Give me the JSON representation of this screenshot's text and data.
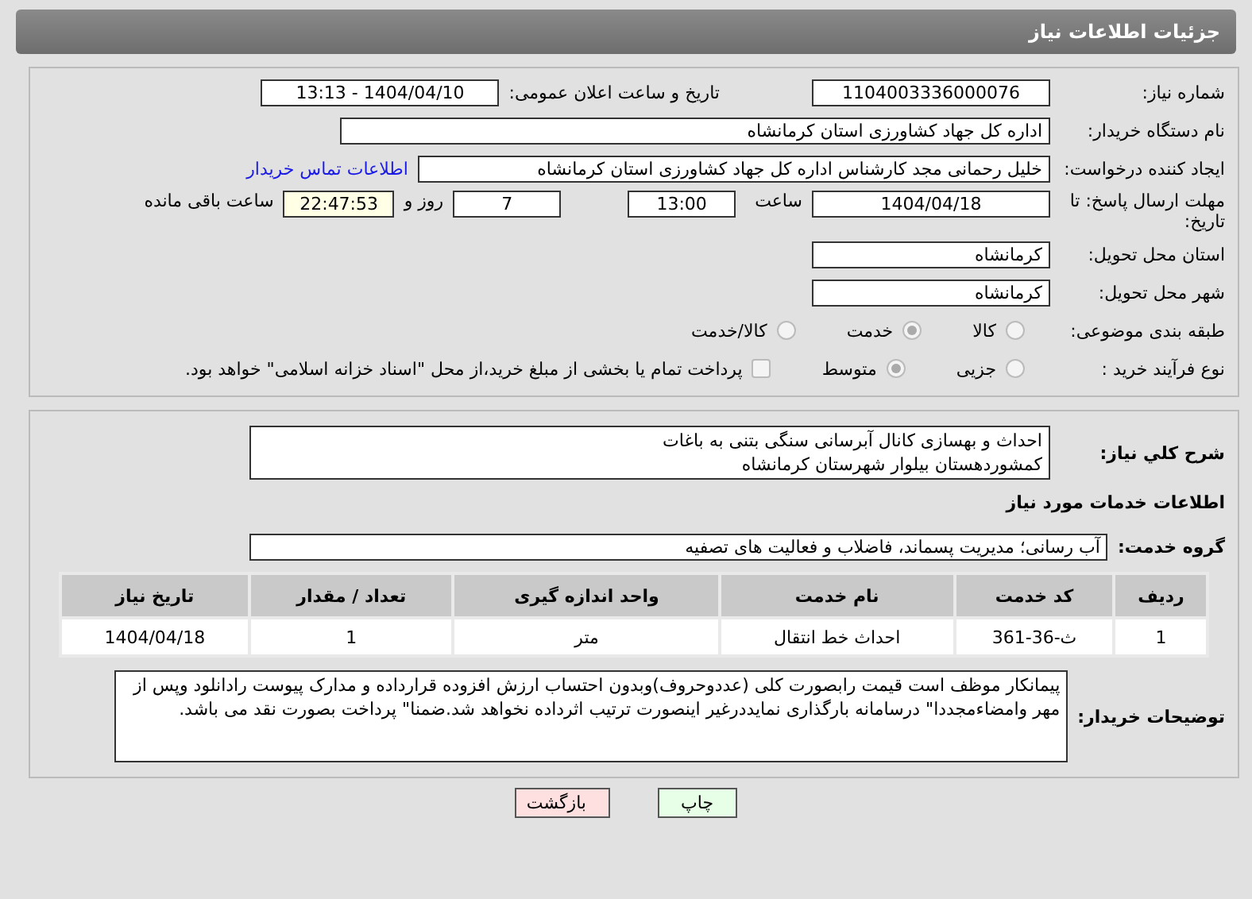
{
  "title": "جزئیات اطلاعات نیاز",
  "need_number": {
    "label": "شماره نیاز:",
    "value": "1104003336000076"
  },
  "announce": {
    "label": "تاریخ و ساعت اعلان عمومی:",
    "value": "1404/04/10 - 13:13"
  },
  "buyer": {
    "label": "نام دستگاه خریدار:",
    "value": "اداره کل جهاد کشاورزی استان کرمانشاه"
  },
  "requester": {
    "label": "ایجاد کننده درخواست:",
    "value": "خلیل رحمانی مجد کارشناس اداره کل جهاد کشاورزی استان کرمانشاه",
    "link": "اطلاعات تماس خریدار"
  },
  "deadline": {
    "label": "مهلت ارسال پاسخ: تا تاریخ:",
    "date": "1404/04/18",
    "time_label": "ساعت",
    "time": "13:00",
    "days": "7",
    "days_label": "روز و",
    "remaining": "22:47:53",
    "remaining_label": "ساعت باقی مانده"
  },
  "province": {
    "label": "استان محل تحویل:",
    "value": "کرمانشاه"
  },
  "city": {
    "label": "شهر محل تحویل:",
    "value": "کرمانشاه"
  },
  "category": {
    "label": "طبقه بندی موضوعی:",
    "options": [
      {
        "label": "کالا",
        "selected": false
      },
      {
        "label": "خدمت",
        "selected": true
      },
      {
        "label": "کالا/خدمت",
        "selected": false
      }
    ]
  },
  "purchase_type": {
    "label": "نوع فرآیند خرید :",
    "options": [
      {
        "label": "جزیی",
        "selected": false
      },
      {
        "label": "متوسط",
        "selected": true
      }
    ],
    "payment": {
      "checked": false,
      "label": "پرداخت تمام یا بخشی از مبلغ خرید،از محل \"اسناد خزانه اسلامی\" خواهد بود."
    }
  },
  "summary": {
    "label": "شرح کلي نیاز:",
    "lines": [
      "احداث و بهسازی کانال آبرسانی سنگی بتنی به باغات",
      "کمشوردهستان بیلوار شهرستان کرمانشاه"
    ]
  },
  "services_title": "اطلاعات خدمات مورد نیاز",
  "service_group": {
    "label": "گروه خدمت:",
    "value": "آب رسانی؛ مدیریت پسماند، فاضلاب و فعالیت های تصفیه"
  },
  "table": {
    "columns": [
      "ردیف",
      "کد خدمت",
      "نام خدمت",
      "واحد اندازه گیری",
      "تعداد / مقدار",
      "تاریخ نیاز"
    ],
    "rows": [
      [
        "1",
        "ث-36-361",
        "احداث خط انتقال",
        "متر",
        "1",
        "1404/04/18"
      ]
    ]
  },
  "notes": {
    "label": "توضیحات خریدار:",
    "value": "پیمانکار موظف است قیمت رابصورت کلی (عددوحروف)وبدون احتساب ارزش افزوده قرارداده و مدارک پیوست رادانلود وپس از مهر وامضاءمجددا\" درسامانه بارگذاری نمایددرغیر اینصورت ترتیب اثرداده نخواهد شد.ضمنا\" پرداخت بصورت نقد می باشد."
  },
  "buttons": [
    {
      "label": "چاپ",
      "kind": "print"
    },
    {
      "label": "بازگشت",
      "kind": "back"
    }
  ]
}
